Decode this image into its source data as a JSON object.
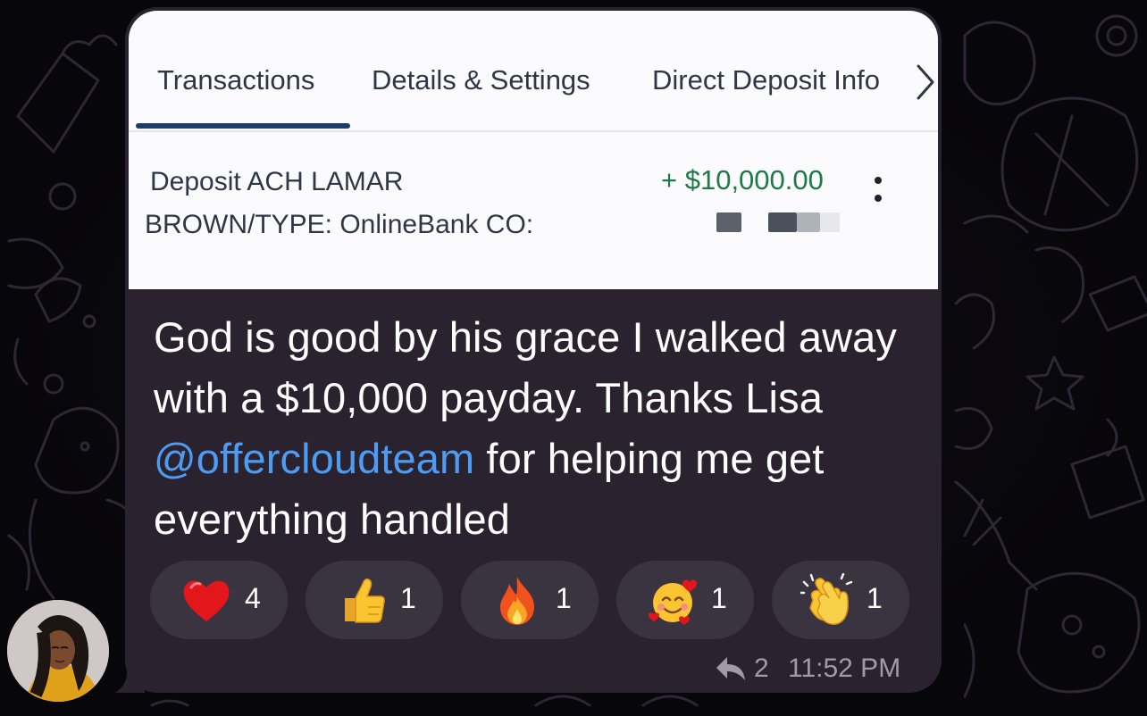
{
  "screenshot": {
    "tabs": [
      {
        "label": "Transactions",
        "active": true
      },
      {
        "label": "Details & Settings",
        "active": false
      },
      {
        "label": "Direct Deposit Info",
        "active": false
      }
    ],
    "transaction": {
      "description_line1": "Deposit ACH LAMAR",
      "description_line2": "BROWN/TYPE: OnlineBank CO:",
      "amount": "+ $10,000.00"
    }
  },
  "message": {
    "text_before": "God is good by his grace I walked away with a $10,000 payday. Thanks Lisa ",
    "mention": "@offercloudteam",
    "text_after": "  for helping me get everything handled"
  },
  "reactions": [
    {
      "emoji": "heart-icon",
      "count": "4"
    },
    {
      "emoji": "thumbs-up-icon",
      "count": "1"
    },
    {
      "emoji": "fire-icon",
      "count": "1"
    },
    {
      "emoji": "smiling-face-with-hearts-icon",
      "count": "1"
    },
    {
      "emoji": "clapping-hands-icon",
      "count": "1"
    }
  ],
  "meta": {
    "reply_count": "2",
    "time": "11:52 PM"
  },
  "colors": {
    "bubble": "#2a232f",
    "mention": "#4d9cf2",
    "amount": "#1e7a46",
    "active_tab_underline": "#1c3d66"
  }
}
